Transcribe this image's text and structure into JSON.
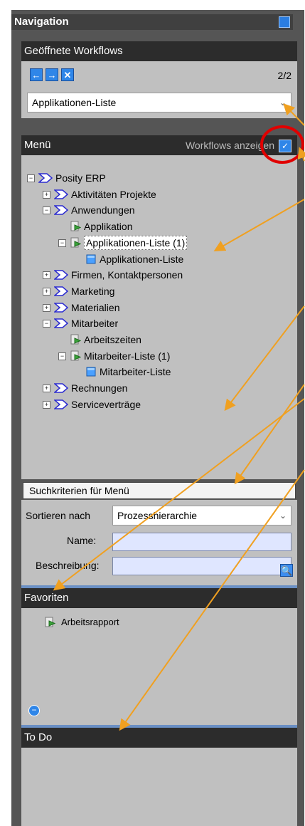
{
  "nav": {
    "title": "Navigation"
  },
  "workflows": {
    "title": "Geöffnete Workflows",
    "count": "2/2",
    "selected": "Applikationen-Liste"
  },
  "menu": {
    "title": "Menü",
    "toggle_label": "Workflows anzeigen",
    "tree": [
      "Posity ERP",
      "Aktivitäten Projekte",
      "Anwendungen",
      "Applikation",
      "Applikationen-Liste (1)",
      "Applikationen-Liste",
      "Firmen, Kontaktpersonen",
      "Marketing",
      "Materialien",
      "Mitarbeiter",
      "Arbeitszeiten",
      "Mitarbeiter-Liste (1)",
      "Mitarbeiter-Liste",
      "Rechnungen",
      "Serviceverträge"
    ]
  },
  "search": {
    "title": "Suchkriterien für Menü",
    "sort_label": "Sortieren nach",
    "sort_value": "Prozesshierarchie",
    "name_label": "Name:",
    "desc_label": "Beschreibung:"
  },
  "favorites": {
    "title": "Favoriten",
    "item": "Arbeitsrapport"
  },
  "todo": {
    "title": "To Do"
  },
  "colors": {
    "accent": "#2f86e8",
    "annotation": "#f0a020",
    "highlight": "#e00000"
  }
}
